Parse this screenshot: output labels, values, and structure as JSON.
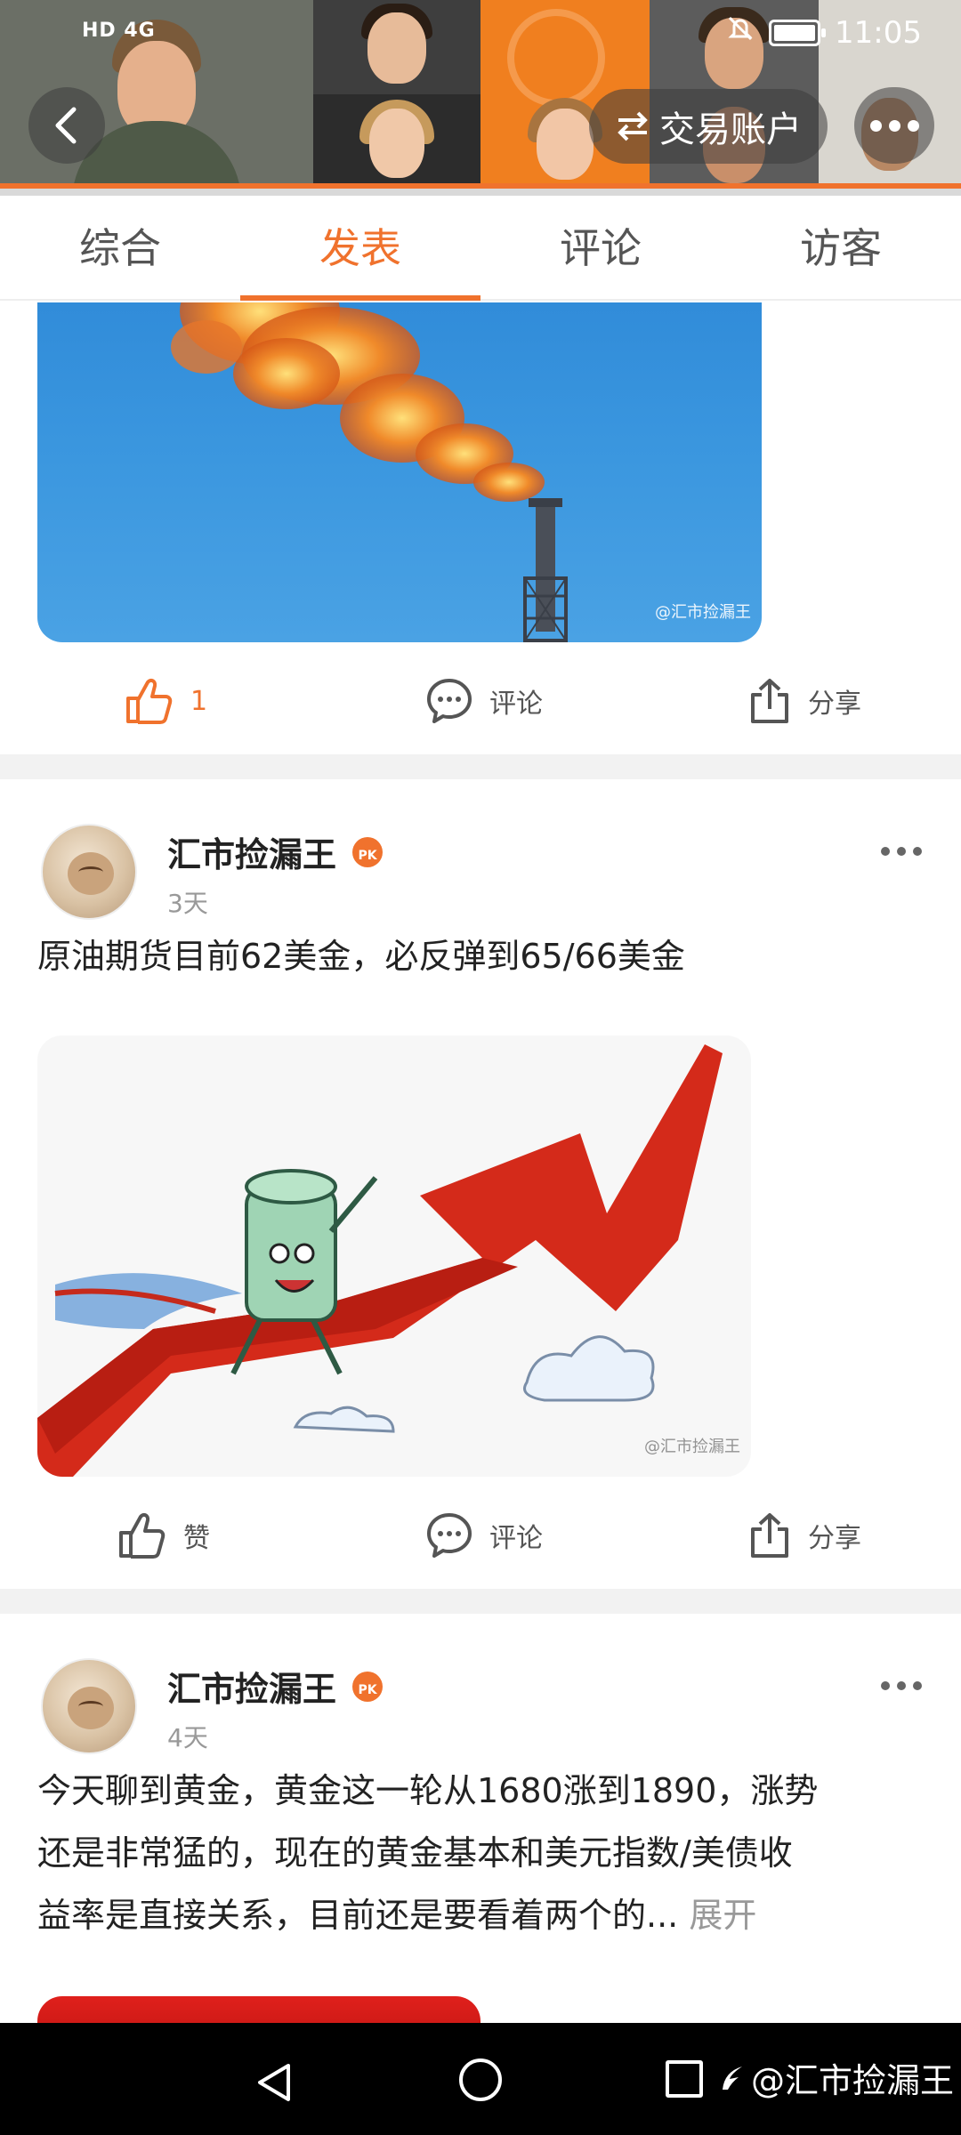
{
  "status_bar": {
    "network_label": "HD 4G",
    "time": "11:05"
  },
  "header": {
    "account_button_label": "交易账户",
    "back_icon": "chevron-left-icon",
    "more_icon": "more-dots-icon"
  },
  "tabs": [
    {
      "label": "综合",
      "active": false
    },
    {
      "label": "发表",
      "active": true
    },
    {
      "label": "评论",
      "active": false
    },
    {
      "label": "访客",
      "active": false
    }
  ],
  "posts": [
    {
      "image_watermark": "@汇市捡漏王",
      "actions": {
        "like_label": "1",
        "liked": true,
        "comment_label": "评论",
        "share_label": "分享"
      }
    },
    {
      "author": "汇市捡漏王",
      "badge": "PK",
      "time": "3天",
      "text": "原油期货目前62美金，必反弹到65/66美金",
      "image_watermark": "@汇市捡漏王",
      "actions": {
        "like_label": "赞",
        "liked": false,
        "comment_label": "评论",
        "share_label": "分享"
      }
    },
    {
      "author": "汇市捡漏王",
      "badge": "PK",
      "time": "4天",
      "text_lines": [
        "今天聊到黄金，黄金这一轮从1680涨到1890，涨势",
        "还是非常猛的，现在的黄金基本和美元指数/美债收",
        "益率是直接关系，目前还是要看着两个的..."
      ],
      "expand_label": "展开"
    }
  ],
  "nav_bar": {
    "watermark": "@汇市捡漏王"
  },
  "colors": {
    "accent": "#f0722d",
    "text": "#222222",
    "muted": "#999999",
    "separator": "#f2f2f2"
  }
}
